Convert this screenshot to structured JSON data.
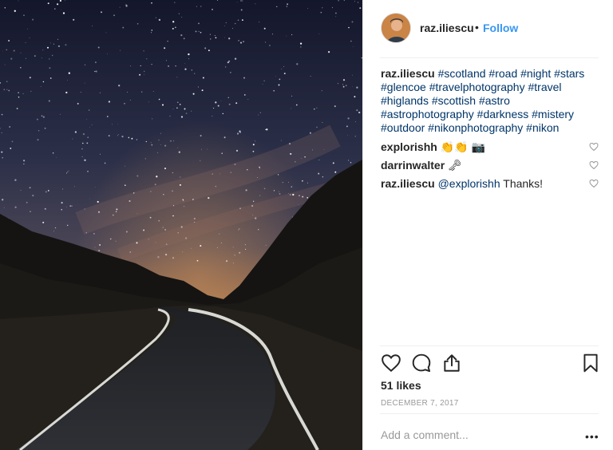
{
  "post": {
    "username": "raz.iliescu",
    "dot": "•",
    "follow_label": "Follow",
    "caption": {
      "username": "raz.iliescu",
      "hashtags": [
        "#scotland",
        "#road",
        "#night",
        "#stars",
        "#glencoe",
        "#travelphotography",
        "#travel",
        "#higlands",
        "#scottish",
        "#astro",
        "#astrophotography",
        "#darkness",
        "#mistery",
        "#outdoor",
        "#nikonphotography",
        "#nikon"
      ]
    },
    "comments": [
      {
        "username": "explorishh",
        "text": "👏👏 📷"
      },
      {
        "username": "darrinwalter",
        "text": "🗝"
      },
      {
        "username": "raz.iliescu",
        "mention": "@explorishh",
        "text": " Thanks!"
      }
    ],
    "likes": "51 likes",
    "date": "DECEMBER 7, 2017",
    "add_comment_placeholder": "Add a comment...",
    "more_label": "•••",
    "icons": {
      "like": "heart-outline-icon",
      "comment": "speech-bubble-icon",
      "share": "share-upload-icon",
      "save": "bookmark-icon",
      "comment_like": "small-heart-icon"
    },
    "colors": {
      "link_blue": "#3897f0",
      "hashtag": "#003569",
      "text": "#262626",
      "muted": "#999999"
    }
  }
}
